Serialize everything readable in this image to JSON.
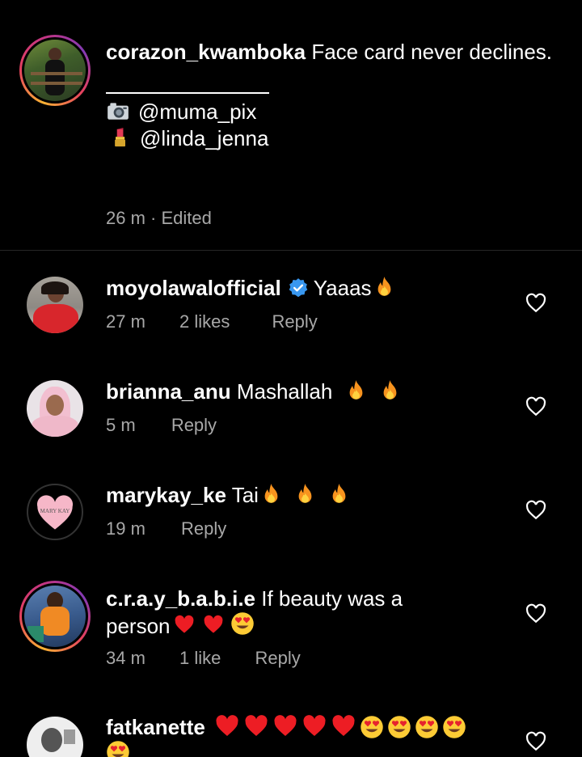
{
  "caption": {
    "username": "corazon_kwamboka",
    "text": "Face card never declines.",
    "line1_icon": "camera-icon",
    "line1": "@muma_pix",
    "line2_icon": "lipstick-icon",
    "line2": "@linda_jenna",
    "time": "26 m",
    "edited": "· Edited"
  },
  "comments": [
    {
      "username": "moyolawalofficial",
      "text": "Yaaas",
      "time": "27 m",
      "likes": "2 likes",
      "reply": "Reply"
    },
    {
      "username": "brianna_anu",
      "text": "Mashallah",
      "time": "5 m",
      "reply": "Reply"
    },
    {
      "username": "marykay_ke",
      "text": "Tai",
      "time": "19 m",
      "reply": "Reply",
      "avatar_text": "MARY KAY"
    },
    {
      "username": "c.r.a.y_b.a.b.i.e",
      "text": "If beauty was a",
      "text2": "person",
      "time": "34 m",
      "likes": "1 like",
      "reply": "Reply"
    },
    {
      "username": "fatkanette",
      "text": ""
    }
  ],
  "colors": {
    "background": "#000000",
    "meta": "#a8a8a8",
    "verified": "#3897f0",
    "heart": "#ed1d24"
  }
}
